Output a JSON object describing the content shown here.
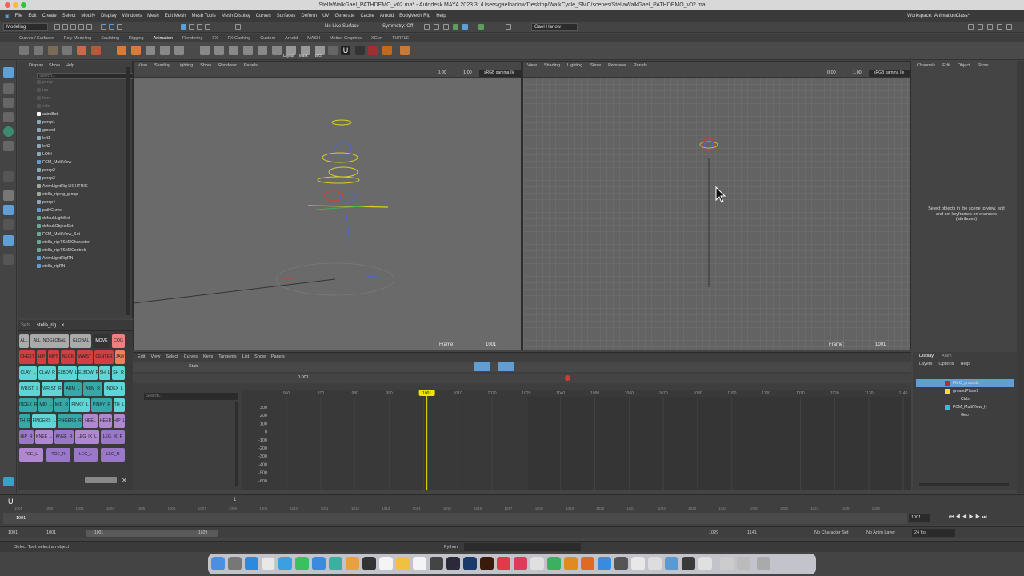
{
  "window": {
    "title": "StellaWalkGael_PATHDEMO_v02.ma* - Autodesk MAYA 2023.3: /Users/gaelharlow/Desktop/WalkCycle_SMC/scenes/StellaWalkGael_PATHDEMO_v02.ma"
  },
  "menubar": {
    "items": [
      "File",
      "Edit",
      "Create",
      "Select",
      "Modify",
      "Display",
      "Windows",
      "Mesh",
      "Edit Mesh",
      "Mesh Tools",
      "Mesh Display",
      "Curves",
      "Surfaces",
      "Deform",
      "UV",
      "Generate",
      "Cache",
      "Arnold",
      "BodyMech Rig",
      "Help"
    ],
    "workspace_label": "Workspace:",
    "workspace_value": "AnimationClass*"
  },
  "statusline": {
    "mode": "Modeling",
    "live_surface": "No Live Surface",
    "symmetry": "Symmetry: Off",
    "user": "Gael Harlow"
  },
  "shelf": {
    "tabs": [
      "Curves / Surfaces",
      "Poly Modeling",
      "Sculpting",
      "Rigging",
      "Animation",
      "Rendering",
      "FX",
      "FX Caching",
      "Custom",
      "Arnold",
      "MASH",
      "Motion Graphics",
      "XGen",
      "TURTLE"
    ],
    "active": "Animation",
    "labels": [
      "Layout",
      "Mask",
      "BIG"
    ]
  },
  "outliner": {
    "menu": [
      "Display",
      "Show",
      "Help"
    ],
    "search_placeholder": "Search...",
    "items": [
      "persp",
      "top",
      "front",
      "side",
      "animBot",
      "persp1",
      "ground",
      "left1",
      "left2",
      "LOKI",
      "FCM_MultiView",
      "persp2",
      "persp3",
      "AnimLightRig LIGHTRIG",
      "stella_rig:rig_group",
      "persp4",
      "pathCurve",
      "defaultLightSet",
      "defaultObjectSet",
      "FCM_MultiView_Set",
      "stella_rig:TSM2Character",
      "stella_rig:TSM2Controls",
      "AnimLightRigRN",
      "stella_rigRN"
    ]
  },
  "picker": {
    "tab_sets": "Sets",
    "tab_rig": "stella_rig",
    "buttons": [
      "ALL",
      "ALL_NOGLOBAL",
      "GLOBAL",
      "MOVE",
      "COG",
      "CHEST",
      "HIP",
      "HIPS",
      "NECK",
      "WAIST",
      "CENTER",
      "JAW",
      "CLAV_L",
      "CLAV_R",
      "ELBOW_L",
      "ELBOW_R",
      "SH_L",
      "SH_R",
      "WRIST_L",
      "WRIST_R",
      "ARM_L",
      "ARM_R",
      "INDEX_L",
      "INDEX_R",
      "MID_L",
      "MID_R",
      "PINKY_L",
      "PINKY_R",
      "TH_L",
      "TH_R",
      "FINGERS_L",
      "FINGERS_R",
      "HEEL",
      "HEER",
      "HIP_L",
      "HIP_R",
      "KNEE_L",
      "KNEE_R",
      "LEG_IK_L",
      "LEG_IK_R",
      "TOE_L",
      "TOE_R",
      "LEG_L",
      "LEG_R"
    ]
  },
  "viewport_menu": [
    "View",
    "Shading",
    "Lighting",
    "Show",
    "Renderer",
    "Panels"
  ],
  "viewport_bar": {
    "val_a": "0.00",
    "val_b": "1.00",
    "colorspace": "sRGB gamma (le"
  },
  "viewport1": {
    "frame_label": "Frame:",
    "frame_value": "1001"
  },
  "viewport2": {
    "frame_label": "Frame:",
    "frame_value": "1001"
  },
  "channel_box": {
    "menu": [
      "Channels",
      "Edit",
      "Object",
      "Show"
    ],
    "hint": "Select objects in the scene to view, edit and set keyframes on channels (attributes)"
  },
  "graph_editor": {
    "menu": [
      "Edit",
      "View",
      "Select",
      "Curves",
      "Keys",
      "Tangents",
      "List",
      "Show",
      "Panels"
    ],
    "stats": "Stats",
    "value_field": "0.001",
    "search_placeholder": "Search...",
    "x_ticks": [
      "960",
      "970",
      "980",
      "990",
      "1000",
      "1010",
      "1020",
      "1029",
      "1040",
      "1050",
      "1060",
      "1070",
      "1080",
      "1090",
      "1100",
      "1110",
      "1120",
      "1130",
      "1140"
    ],
    "current_frame": "1001",
    "y_ticks": [
      "300",
      "200",
      "100",
      "0",
      "-100",
      "-200",
      "-300",
      "-400",
      "-500",
      "-600"
    ]
  },
  "layers": {
    "tabs": [
      "Display",
      "Anim"
    ],
    "menu": [
      "Layers",
      "Options",
      "Help"
    ],
    "rows": [
      "FMC_grounds",
      "groundPlane1",
      "Ctrls",
      "FCM_MultiView_ly",
      "Geo"
    ]
  },
  "timeslider": {
    "left_value": "1",
    "current": "1001",
    "ticks": [
      "1001",
      "1002",
      "1003",
      "1004",
      "1005",
      "1006",
      "1007",
      "1008",
      "1009",
      "1010",
      "1011",
      "1012",
      "1013",
      "1014",
      "1015",
      "1016",
      "1017",
      "1018",
      "1019",
      "1020",
      "1021",
      "1022",
      "1023",
      "1024",
      "1025",
      "1026",
      "1027",
      "1028",
      "1029"
    ],
    "right_value": "1001"
  },
  "range": {
    "start": "1001",
    "inner_start": "1001",
    "bar_start": "1001",
    "bar_end": "1029",
    "end": "1029",
    "outer_end": "1141",
    "char_set": "No Character Set",
    "anim_layer": "No Anim Layer",
    "fps": "24 fps"
  },
  "cmdline": {
    "help": "Select Tool: select an object",
    "lang": "Python"
  },
  "colors": {
    "accent": "#5f9fd6",
    "current_time": "#f2e200",
    "key_red": "#d23a3a"
  }
}
